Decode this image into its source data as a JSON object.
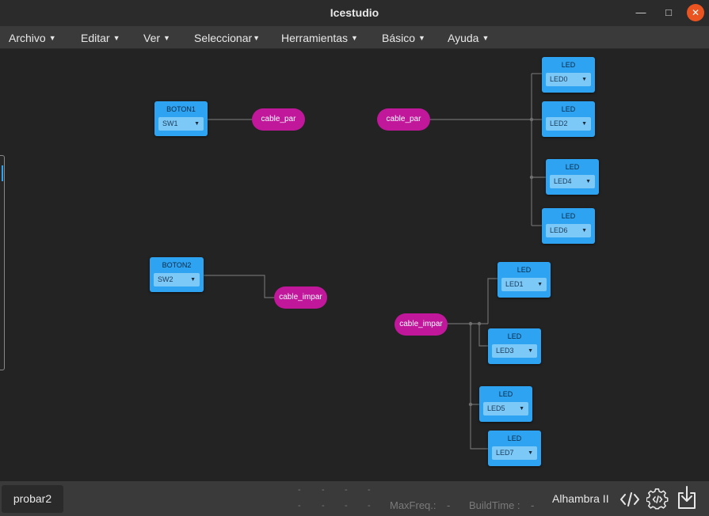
{
  "window": {
    "title": "Icestudio"
  },
  "menu": [
    {
      "label": "Archivo"
    },
    {
      "label": "Editar"
    },
    {
      "label": "Ver"
    },
    {
      "label": "Seleccionar"
    },
    {
      "label": "Herramientas"
    },
    {
      "label": "Básico"
    },
    {
      "label": "Ayuda"
    }
  ],
  "blocks": {
    "boton1": {
      "title": "BOTON1",
      "value": "SW1"
    },
    "boton2": {
      "title": "BOTON2",
      "value": "SW2"
    },
    "led0": {
      "title": "LED",
      "value": "LED0"
    },
    "led2": {
      "title": "LED",
      "value": "LED2"
    },
    "led4": {
      "title": "LED",
      "value": "LED4"
    },
    "led6": {
      "title": "LED",
      "value": "LED6"
    },
    "led1": {
      "title": "LED",
      "value": "LED1"
    },
    "led3": {
      "title": "LED",
      "value": "LED3"
    },
    "led5": {
      "title": "LED",
      "value": "LED5"
    },
    "led7": {
      "title": "LED",
      "value": "LED7"
    }
  },
  "labels": {
    "cable_par_out": "cable_par",
    "cable_par_in": "cable_par",
    "cable_impar_out": "cable_impar",
    "cable_impar_in": "cable_impar"
  },
  "status": {
    "project": "probar2",
    "dash": "-",
    "maxfreq_label": "MaxFreq.:",
    "maxfreq_value": "-",
    "buildtime_label": "BuildTime :",
    "buildtime_value": "-",
    "board": "Alhambra II"
  },
  "icons": {
    "verify": "code-icon",
    "build": "gear-code-icon",
    "upload": "upload-icon"
  },
  "colors": {
    "block": "#2ea3f2",
    "label": "#c0179b",
    "close": "#e95420"
  }
}
